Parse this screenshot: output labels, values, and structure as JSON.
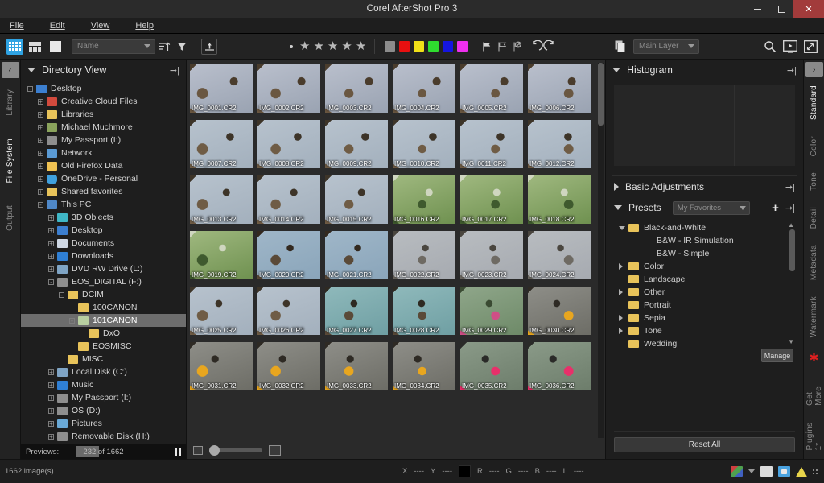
{
  "window": {
    "title": "Corel AfterShot Pro 3",
    "minimize": "–",
    "maximize": "□",
    "close": "✕"
  },
  "menubar": {
    "items": [
      {
        "label": "File"
      },
      {
        "label": "Edit"
      },
      {
        "label": "View"
      },
      {
        "label": "Help"
      }
    ]
  },
  "toolbar": {
    "view_modes": [
      "grid-view-icon",
      "filmstrip-view-icon",
      "single-view-icon"
    ],
    "sort_field": "Name",
    "sort_direction_icon": "sort-ascending-icon",
    "filter_icon": "funnel-filter-icon",
    "export_icon": "export-up-icon",
    "rating": {
      "reject_dot": "•",
      "stars": 5,
      "filled": 0
    },
    "color_labels": [
      "#8c8c8c",
      "#e81010",
      "#f0e018",
      "#2fdd2f",
      "#1515e0",
      "#ee2fee"
    ],
    "flags": [
      "flag-pick-icon",
      "flag-outline-icon",
      "flag-reject-icon"
    ],
    "undo_icon": "undo-icon",
    "redo_icon": "redo-icon",
    "layer_icon": "copy-layer-icon",
    "layer_value": "Main Layer",
    "search_icon": "search-icon",
    "slideshow_icon": "slideshow-icon",
    "fullscreen_icon": "fullscreen-icon"
  },
  "left_tabs": {
    "collapse_label": "‹",
    "items": [
      {
        "label": "Library",
        "active": false
      },
      {
        "label": "File System",
        "active": true
      },
      {
        "label": "Output",
        "active": false
      }
    ]
  },
  "directory_panel": {
    "title": "Directory View",
    "pin_icon": "pin-icon",
    "tree": [
      {
        "label": "Desktop",
        "depth": 0,
        "icon": "blue",
        "expander": "-"
      },
      {
        "label": "Creative Cloud Files",
        "depth": 1,
        "icon": "cc",
        "expander": "+"
      },
      {
        "label": "Libraries",
        "depth": 1,
        "icon": "lib",
        "expander": "+"
      },
      {
        "label": "Michael Muchmore",
        "depth": 1,
        "icon": "person",
        "expander": "+"
      },
      {
        "label": "My Passport (I:)",
        "depth": 1,
        "icon": "drive",
        "expander": "+"
      },
      {
        "label": "Network",
        "depth": 1,
        "icon": "net",
        "expander": "+"
      },
      {
        "label": "Old Firefox Data",
        "depth": 1,
        "icon": "ff",
        "expander": "+"
      },
      {
        "label": "OneDrive - Personal",
        "depth": 1,
        "icon": "cloud",
        "expander": "+"
      },
      {
        "label": "Shared favorites",
        "depth": 1,
        "icon": "folder",
        "expander": "+"
      },
      {
        "label": "This PC",
        "depth": 1,
        "icon": "pc",
        "expander": "-"
      },
      {
        "label": "3D Objects",
        "depth": 2,
        "icon": "obj3d",
        "expander": "+"
      },
      {
        "label": "Desktop",
        "depth": 2,
        "icon": "blue",
        "expander": "+"
      },
      {
        "label": "Documents",
        "depth": 2,
        "icon": "doc",
        "expander": "+"
      },
      {
        "label": "Downloads",
        "depth": 2,
        "icon": "down",
        "expander": "+"
      },
      {
        "label": "DVD RW Drive (L:)",
        "depth": 2,
        "icon": "disk",
        "expander": "+"
      },
      {
        "label": "EOS_DIGITAL (F:)",
        "depth": 2,
        "icon": "drive",
        "expander": "-"
      },
      {
        "label": "DCIM",
        "depth": 3,
        "icon": "folder",
        "expander": "-"
      },
      {
        "label": "100CANON",
        "depth": 4,
        "icon": "folder",
        "expander": ""
      },
      {
        "label": "101CANON",
        "depth": 4,
        "icon": "folder-green",
        "expander": "-",
        "selected": true
      },
      {
        "label": "DxO",
        "depth": 5,
        "icon": "folder",
        "expander": ""
      },
      {
        "label": "EOSMISC",
        "depth": 4,
        "icon": "folder",
        "expander": ""
      },
      {
        "label": "MISC",
        "depth": 3,
        "icon": "folder",
        "expander": ""
      },
      {
        "label": "Local Disk (C:)",
        "depth": 2,
        "icon": "disk",
        "expander": "+"
      },
      {
        "label": "Music",
        "depth": 2,
        "icon": "music",
        "expander": "+"
      },
      {
        "label": "My Passport (I:)",
        "depth": 2,
        "icon": "drive",
        "expander": "+"
      },
      {
        "label": "OS (D:)",
        "depth": 2,
        "icon": "drive",
        "expander": "+"
      },
      {
        "label": "Pictures",
        "depth": 2,
        "icon": "pic",
        "expander": "+"
      },
      {
        "label": "Removable Disk (H:)",
        "depth": 2,
        "icon": "drive",
        "expander": "+"
      }
    ],
    "progress": {
      "label": "Previews:",
      "count_text": "232 of 1662",
      "percent": 14,
      "pause_icon": "pause-icon"
    }
  },
  "browser": {
    "rows": [
      {
        "thumbs": [
          {
            "name": "IMG_0001.CR2",
            "theme": "winter"
          },
          {
            "name": "IMG_0002.CR2",
            "theme": "winter"
          },
          {
            "name": "IMG_0003.CR2",
            "theme": "winter"
          },
          {
            "name": "IMG_0004.CR2",
            "theme": "winter"
          },
          {
            "name": "IMG_0005.CR2",
            "theme": "winter"
          },
          {
            "name": "IMG_0006.CR2",
            "theme": "winter"
          }
        ]
      },
      {
        "thumbs": [
          {
            "name": "IMG_0007.CR2",
            "theme": "branch"
          },
          {
            "name": "IMG_0008.CR2",
            "theme": "branch"
          },
          {
            "name": "IMG_0009.CR2",
            "theme": "branch"
          },
          {
            "name": "IMG_0010.CR2",
            "theme": "branch"
          },
          {
            "name": "IMG_0011.CR2",
            "theme": "branch"
          },
          {
            "name": "IMG_0012.CR2",
            "theme": "branch"
          }
        ]
      },
      {
        "thumbs": [
          {
            "name": "IMG_0013.CR2",
            "theme": "branch"
          },
          {
            "name": "IMG_0014.CR2",
            "theme": "branch"
          },
          {
            "name": "IMG_0015.CR2",
            "theme": "branch"
          },
          {
            "name": "IMG_0016.CR2",
            "theme": "green"
          },
          {
            "name": "IMG_0017.CR2",
            "theme": "green"
          },
          {
            "name": "IMG_0018.CR2",
            "theme": "green"
          }
        ]
      },
      {
        "thumbs": [
          {
            "name": "IMG_0019.CR2",
            "theme": "green"
          },
          {
            "name": "IMG_0020.CR2",
            "theme": "sky"
          },
          {
            "name": "IMG_0021.CR2",
            "theme": "sky"
          },
          {
            "name": "IMG_0022.CR2",
            "theme": "grey"
          },
          {
            "name": "IMG_0023.CR2",
            "theme": "grey"
          },
          {
            "name": "IMG_0024.CR2",
            "theme": "grey"
          }
        ]
      },
      {
        "thumbs": [
          {
            "name": "IMG_0025.CR2",
            "theme": "branch"
          },
          {
            "name": "IMG_0026.CR2",
            "theme": "branch"
          },
          {
            "name": "IMG_0027.CR2",
            "theme": "teal"
          },
          {
            "name": "IMG_0028.CR2",
            "theme": "teal"
          },
          {
            "name": "IMG_0029.CR2",
            "theme": "bloom"
          },
          {
            "name": "IMG_0030.CR2",
            "theme": "bird"
          }
        ]
      },
      {
        "thumbs": [
          {
            "name": "IMG_0031.CR2",
            "theme": "bird"
          },
          {
            "name": "IMG_0032.CR2",
            "theme": "bird"
          },
          {
            "name": "IMG_0033.CR2",
            "theme": "bird"
          },
          {
            "name": "IMG_0034.CR2",
            "theme": "bird"
          },
          {
            "name": "IMG_0035.CR2",
            "theme": "feeder"
          },
          {
            "name": "IMG_0036.CR2",
            "theme": "feeder"
          }
        ]
      }
    ],
    "zoom_small_icon": "thumbnail-small-icon",
    "zoom_large_icon": "thumbnail-large-icon"
  },
  "right_panel": {
    "histogram": {
      "title": "Histogram",
      "pin_icon": "pin-icon"
    },
    "basic_adjustments": {
      "title": "Basic Adjustments",
      "pin_icon": "pin-icon"
    },
    "presets": {
      "title": "Presets",
      "selected_set": "My Favorites",
      "add_icon": "plus-icon",
      "pin_icon": "pin-icon",
      "manage_label": "Manage",
      "items": [
        {
          "label": "Black-and-White",
          "type": "folder",
          "depth": 0,
          "expander": "down"
        },
        {
          "label": "B&W - IR Simulation",
          "type": "item",
          "depth": 1
        },
        {
          "label": "B&W - Simple",
          "type": "item",
          "depth": 1
        },
        {
          "label": "Color",
          "type": "folder",
          "depth": 0,
          "expander": "right"
        },
        {
          "label": "Landscape",
          "type": "folder",
          "depth": 0,
          "expander": ""
        },
        {
          "label": "Other",
          "type": "folder",
          "depth": 0,
          "expander": "right"
        },
        {
          "label": "Portrait",
          "type": "folder",
          "depth": 0,
          "expander": ""
        },
        {
          "label": "Sepia",
          "type": "folder",
          "depth": 0,
          "expander": "right"
        },
        {
          "label": "Tone",
          "type": "folder",
          "depth": 0,
          "expander": "right"
        },
        {
          "label": "Wedding",
          "type": "folder",
          "depth": 0,
          "expander": ""
        }
      ]
    },
    "reset_all_label": "Reset All"
  },
  "right_tabs": {
    "collapse_label": "›",
    "items": [
      {
        "label": "Standard",
        "active": true
      },
      {
        "label": "Color",
        "active": false
      },
      {
        "label": "Tone",
        "active": false
      },
      {
        "label": "Detail",
        "active": false
      },
      {
        "label": "Metadata",
        "active": false
      },
      {
        "label": "Watermark",
        "active": false
      },
      {
        "label": "Get More",
        "active": false,
        "star": true
      },
      {
        "label": "Plugins 1*",
        "active": false
      }
    ]
  },
  "statusbar": {
    "image_count": "1662 image(s)",
    "x_label": "X",
    "x_value": "----",
    "y_label": "Y",
    "y_value": "----",
    "r_label": "R",
    "r_value": "----",
    "g_label": "G",
    "g_value": "----",
    "b_label": "B",
    "b_value": "----",
    "l_label": "L",
    "l_value": "----",
    "icons": [
      "color-profile-icon",
      "chevron-down-icon",
      "filmstrip-icon",
      "lock-icon",
      "warning-icon",
      "resize-grip-icon"
    ]
  }
}
